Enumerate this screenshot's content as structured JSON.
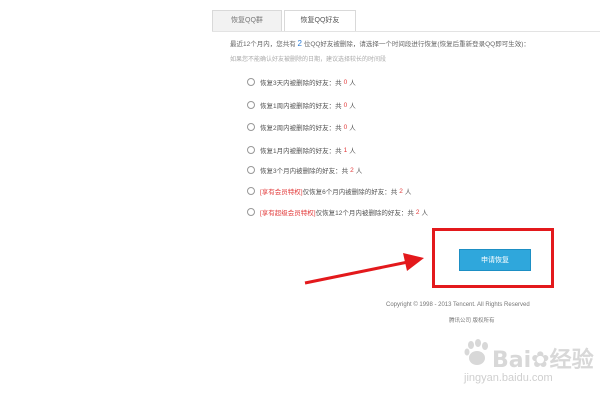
{
  "tabs": [
    {
      "label": "恢复QQ群"
    },
    {
      "label": "恢复QQ好友"
    }
  ],
  "intro": {
    "before": "最近12个月内，您共有",
    "count": "2",
    "after": "位QQ好友被删除，请选择一个时间段进行恢复(恢复后重新登录QQ即可生效)：",
    "note": "如果您不能确认好友被删除的日期，建议选择较长的时间段"
  },
  "options": [
    {
      "vip": "",
      "label": "恢复3天内被删除的好友：共",
      "count": "0",
      "unit": "人"
    },
    {
      "vip": "",
      "label": "恢复1周内被删除的好友：共",
      "count": "0",
      "unit": "人"
    },
    {
      "vip": "",
      "label": "恢复2周内被删除的好友：共",
      "count": "0",
      "unit": "人"
    },
    {
      "vip": "",
      "label": "恢复1月内被删除的好友：共",
      "count": "1",
      "unit": "人"
    },
    {
      "vip": "",
      "label": "恢复3个月内被删除的好友：共",
      "count": "2",
      "unit": "人"
    },
    {
      "vip": "[享有会员特权]",
      "label": "仅恢复6个月内被删除的好友：共",
      "count": "2",
      "unit": "人"
    },
    {
      "vip": "[享有超级会员特权]",
      "label": "仅恢复12个月内被删除的好友：共",
      "count": "2",
      "unit": "人"
    }
  ],
  "apply_button": "申请恢复",
  "footer": {
    "copyright": "Copyright © 1998 - 2013 Tencent. All Rights Reserved",
    "links": "腾讯公司 版权所有"
  },
  "watermark": {
    "brand": "Bai",
    "brand2": "经验",
    "url": "jingyan.baidu.com"
  },
  "colors": {
    "accent": "#2fa7dc",
    "highlight": "#e3191c",
    "count": "#e23b3b"
  }
}
